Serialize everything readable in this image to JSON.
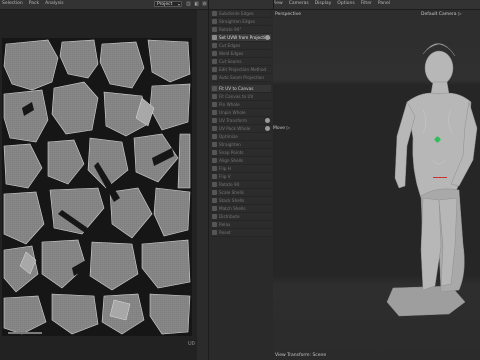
{
  "topbar": {
    "left_menu": [
      "Selection",
      "Pack",
      "Analysis"
    ],
    "mode_select": "Project",
    "right_menu": [
      "View",
      "Cameras",
      "Display",
      "Options",
      "Filter",
      "Panel"
    ]
  },
  "uv_panel": {
    "tile_label": "U0"
  },
  "tool_panel": {
    "items": [
      {
        "label": "Subdivide Edges",
        "state": "dim"
      },
      {
        "label": "Straighten Edges",
        "state": "dim"
      },
      {
        "label": "Rotate 90°",
        "state": "dim"
      },
      {
        "label": "Set UVW from Projection",
        "state": "active",
        "badge": true
      },
      {
        "label": "Cut Edges",
        "state": "dim"
      },
      {
        "label": "Weld Edges",
        "state": "dim"
      },
      {
        "label": "Cut Seams",
        "state": "dim"
      },
      {
        "label": "Edit Projection Method",
        "state": "dim"
      },
      {
        "label": "Auto Seam Projection",
        "state": "dim"
      },
      {
        "label": "Fit UV to Canvas",
        "state": "section"
      },
      {
        "label": "Fit Canvas to UV",
        "state": "dim"
      },
      {
        "label": "Pin Whole",
        "state": "dim"
      },
      {
        "label": "Unpin Whole",
        "state": "dim"
      },
      {
        "label": "UV Transform",
        "state": "dim",
        "badge": true
      },
      {
        "label": "UV Pack Whole",
        "state": "dim",
        "badge": true
      },
      {
        "label": "Optimize",
        "state": "dim"
      },
      {
        "label": "Straighten",
        "state": "dim"
      },
      {
        "label": "Snap Points",
        "state": "dim"
      },
      {
        "label": "Align Shells",
        "state": "dim"
      },
      {
        "label": "Flip H",
        "state": "dim"
      },
      {
        "label": "Flip V",
        "state": "dim"
      },
      {
        "label": "Rotate 90",
        "state": "dim"
      },
      {
        "label": "Scale Shells",
        "state": "dim"
      },
      {
        "label": "Stack Shells",
        "state": "dim"
      },
      {
        "label": "Match Shells",
        "state": "dim"
      },
      {
        "label": "Distribute",
        "state": "dim"
      },
      {
        "label": "Relax",
        "state": "dim"
      },
      {
        "label": "Reset",
        "state": "dim"
      }
    ]
  },
  "viewport": {
    "label_perspective": "Perspective",
    "label_camera": "Default Camera ▷",
    "label_move": "Move ▷",
    "label_bottom": "View Transform: Scene",
    "gizmo_red": "#c83232",
    "gizmo_green": "#2fbf5a"
  },
  "colors": {
    "uv_shell_fill": "#8e8e8e",
    "uv_shell_edge": "#d0d0d0",
    "model": "#bdbdbd"
  }
}
